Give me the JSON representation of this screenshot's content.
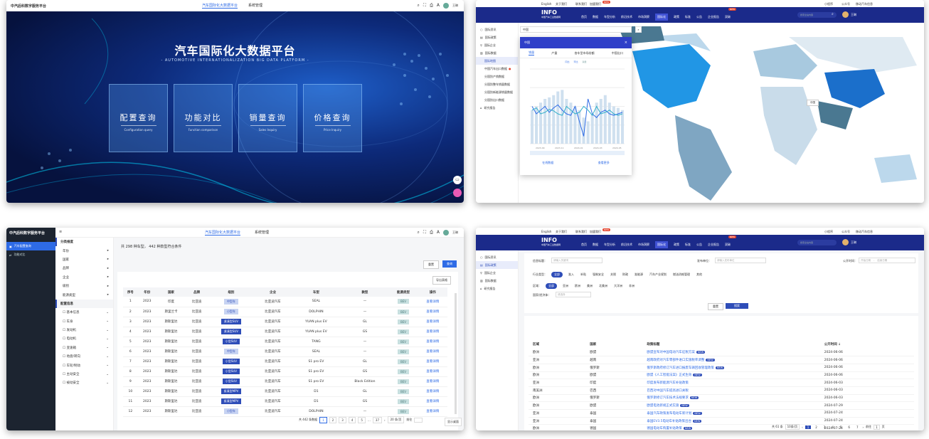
{
  "p1": {
    "brand": "中汽后科数字服务平台",
    "tabs": [
      "汽车国际化大数据平台",
      "系统管理"
    ],
    "user": "王琳",
    "title": "汽车国际化大数据平台",
    "subtitle": "- AUTOMOTIVE INTERNATIONALIZATION BIG DATA PLATFORM -",
    "cards": [
      {
        "cn": "配置查询",
        "en": "Configuration query"
      },
      {
        "cn": "功能对比",
        "en": "Function comparison"
      },
      {
        "cn": "销量查询",
        "en": "Sales Inquiry"
      },
      {
        "cn": "价格查询",
        "en": "Price Inquiry"
      }
    ]
  },
  "p2": {
    "toplinks": [
      "English",
      "关于我们",
      "联系我们",
      "加盟我们"
    ],
    "badge": "NEW",
    "toplinks_right": [
      "小程序",
      "公众号",
      "移动汽车信息"
    ],
    "logo": "INFO",
    "logo_sub": "中国汽车工业数据网",
    "nav": [
      "首页",
      "数据",
      "车型分析",
      "前沿技术",
      "市场洞察",
      "国际化",
      "政策",
      "标准",
      "公告",
      "企业报告",
      "双碳"
    ],
    "nav_badge": "NEW",
    "search_placeholder": "搜索全站内容",
    "user": "王琳",
    "side": [
      "国际资讯",
      "国际政策",
      "国际企业",
      "国际数据",
      "国际地图",
      "中国汽车出口数据",
      "分国别产销数据",
      "分国别整车销量数据",
      "分国别新能源销量数据",
      "分国别出口数据",
      "研究报告"
    ],
    "country_input": "中国",
    "popup": {
      "title": "中国",
      "tabs": [
        "销量",
        "产量",
        "各车型市场份额",
        "中国出口"
      ],
      "legend": [
        "同比",
        "环比",
        "销量"
      ],
      "xticks": [
        "2023-09",
        "2023-11",
        "2024-01",
        "2024-03",
        "2024-05"
      ],
      "footer": [
        "在线数据",
        "查看更多"
      ]
    },
    "map_label": "中国"
  },
  "p3": {
    "brand": "中汽后科数字服务平台",
    "tabs": [
      "汽车国际化大数据平台",
      "系统管理"
    ],
    "user": "王琳",
    "side": [
      "汽车配置查询",
      "功能对比"
    ],
    "filter_head": "分类维度",
    "filters": [
      "年份",
      "国家",
      "品牌",
      "企业",
      "级别",
      "能源类型"
    ],
    "filter_head2": "配置信息",
    "filters2": [
      "基本信息",
      "车身",
      "发动机",
      "电动机",
      "变速箱",
      "地盘/转向",
      "车轮/制动",
      "主动安全",
      "被动安全"
    ],
    "summary": "共 298 种车型， 442 种款型符合条件",
    "buttons": [
      "重置",
      "查询"
    ],
    "export": "导出表格",
    "columns": [
      "序号",
      "年份",
      "国家",
      "品牌",
      "级别",
      "企业",
      "车型",
      "款型",
      "能源类型",
      "操作"
    ],
    "rows": [
      [
        "1",
        "2023",
        "印度",
        "比亚迪",
        "中型车",
        "比亚迪汽车",
        "SEAL",
        "—",
        "BEV",
        "查看详情"
      ],
      [
        "2",
        "2023",
        "斯里兰卡",
        "比亚迪",
        "小型车",
        "比亚迪汽车",
        "DOLPHIN",
        "—",
        "BEV",
        "查看详情"
      ],
      [
        "3",
        "2023",
        "斯斯里达",
        "比亚迪",
        "紧凑型SUV",
        "比亚迪汽车",
        "YUAN plus EV",
        "GL",
        "BEV",
        "查看详情"
      ],
      [
        "4",
        "2023",
        "斯斯里达",
        "比亚迪",
        "紧凑型SUV",
        "比亚迪汽车",
        "YUAN plus EV",
        "GS",
        "BEV",
        "查看详情"
      ],
      [
        "5",
        "2023",
        "斯斯里达",
        "比亚迪",
        "小型SUV",
        "比亚迪汽车",
        "TANG",
        "—",
        "BEV",
        "查看详情"
      ],
      [
        "6",
        "2023",
        "斯斯里达",
        "比亚迪",
        "中型车",
        "比亚迪汽车",
        "SEAL",
        "—",
        "BEV",
        "查看详情"
      ],
      [
        "7",
        "2023",
        "斯斯里达",
        "比亚迪",
        "小型SUV",
        "比亚迪汽车",
        "S1 pro EV",
        "GL",
        "BEV",
        "查看详情"
      ],
      [
        "8",
        "2023",
        "斯斯里达",
        "比亚迪",
        "小型SUV",
        "比亚迪汽车",
        "S1 pro EV",
        "GS",
        "BEV",
        "查看详情"
      ],
      [
        "9",
        "2023",
        "斯斯里达",
        "比亚迪",
        "小型SUV",
        "比亚迪汽车",
        "S1 pro EV",
        "Black Edition",
        "BEV",
        "查看详情"
      ],
      [
        "10",
        "2023",
        "斯斯里达",
        "比亚迪",
        "紧凑型MPV",
        "比亚迪汽车",
        "D1",
        "GL",
        "BEV",
        "查看详情"
      ],
      [
        "11",
        "2023",
        "斯斯里达",
        "比亚迪",
        "紧凑型MPV",
        "比亚迪汽车",
        "D1",
        "GS",
        "BEV",
        "查看详情"
      ],
      [
        "12",
        "2023",
        "斯斯里达",
        "比亚迪",
        "小型车",
        "比亚迪汽车",
        "DOLPHIN",
        "—",
        "BEV",
        "查看详情"
      ]
    ],
    "pager": {
      "total": "共 442 条数据",
      "pages": [
        "1",
        "2",
        "3",
        "4",
        "5",
        "…",
        "37"
      ],
      "size": "20 条/页",
      "goto": "前往"
    },
    "show_desktop": "显示桌面"
  },
  "p4": {
    "search_label": "信息标题：",
    "search_placeholder": "请输入关键词",
    "pub_label": "发布单位：",
    "pub_placeholder": "请输入发布单位",
    "time_label": "公开时间：",
    "date_start": "开始日期",
    "date_end": "结束日期",
    "type_label": "行业类型：",
    "types": [
      "全部",
      "准入",
      "补贴",
      "强制安全",
      "关税",
      "财政",
      "准能源",
      "汽车产业规划",
      "燃油消耗管理",
      "其他"
    ],
    "region_label": "区域：",
    "regions": [
      "全部",
      "亚洲",
      "欧洲",
      "美洲",
      "北美洲",
      "大洋洲",
      "非洲"
    ],
    "country_label": "国家/经济体：",
    "country_placeholder": "请选择",
    "buttons": [
      "重置",
      "搜索"
    ],
    "columns": [
      "区域",
      "国家",
      "政策标题",
      "公开时间 ↓"
    ],
    "rows": [
      [
        "欧洲",
        "欧盟",
        "欧盟宣布对中国电动汽车征税方案",
        "2024-06-06"
      ],
      [
        "亚洲",
        "越南",
        "越南政府对汽车零部件进口实施税率调整",
        "2024-06-06"
      ],
      [
        "欧洲",
        "俄罗斯",
        "俄罗斯政府修订汽车进口报废车辆回收管理政策",
        "2024-06-06"
      ],
      [
        "欧洲",
        "欧盟",
        "欧盟《人工智能法案》正式生效",
        "2024-06-06"
      ],
      [
        "亚洲",
        "印度",
        "印度发布新能源汽车补贴政策",
        "2024-06-03"
      ],
      [
        "南美洲",
        "巴西",
        "巴西对中国汽车提高进口关税",
        "2024-06-03"
      ],
      [
        "欧洲",
        "俄罗斯",
        "俄罗斯修订汽车技术法规要求",
        "2024-06-03"
      ],
      [
        "欧洲",
        "欧盟",
        "欧盟电池新规正式实施",
        "2024-07-29"
      ],
      [
        "亚洲",
        "泰国",
        "泰国汽车政策发布电动车新计划",
        "2024-07-24"
      ],
      [
        "亚洲",
        "泰国",
        "泰国EV3.5电动车补贴政策出台",
        "2024-07-24"
      ],
      [
        "欧洲",
        "德国",
        "德国电动车购置补贴政策",
        "2024-07-24"
      ]
    ],
    "pager": {
      "total": "共 61 条",
      "size": "10条/页",
      "pages": [
        "1",
        "2",
        "3",
        "4",
        "5",
        "6",
        "7"
      ],
      "goto": "前往",
      "page": "1",
      "unit": "页"
    }
  }
}
